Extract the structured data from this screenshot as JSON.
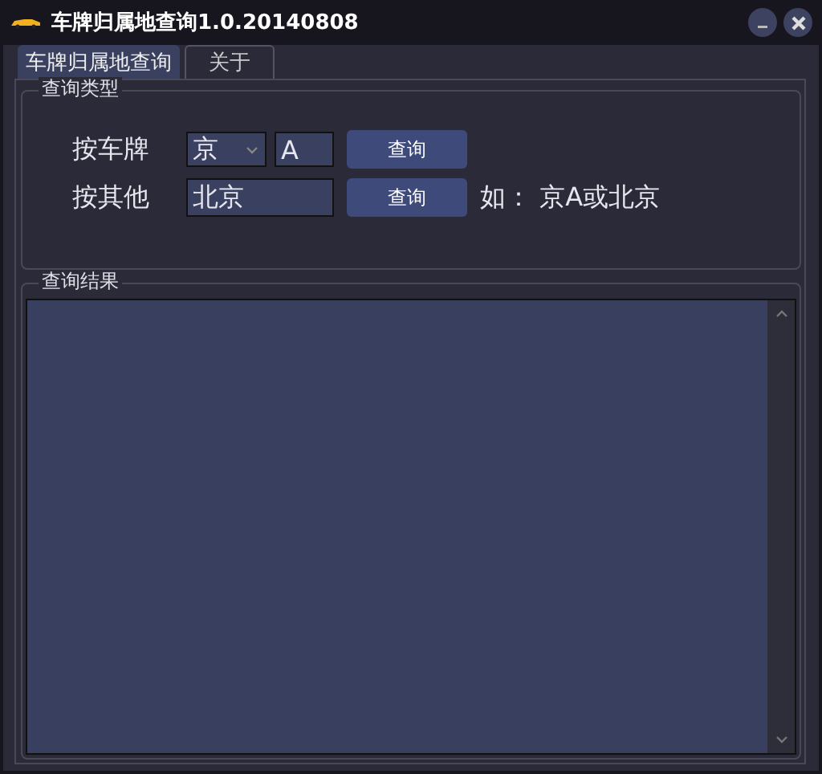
{
  "window": {
    "title": "车牌归属地查询",
    "version": "1.0.20140808"
  },
  "tabs": [
    {
      "label": "车牌归属地查询",
      "selected": true
    },
    {
      "label": "关于",
      "selected": false
    }
  ],
  "query_type": {
    "title": "查询类型",
    "by_plate": {
      "label": "按车牌",
      "province": "京",
      "letter": "A",
      "button": "查询"
    },
    "by_other": {
      "label": "按其他",
      "value": "北京",
      "button": "查询",
      "hint": "如： 京A或北京"
    }
  },
  "results": {
    "title": "查询结果"
  }
}
